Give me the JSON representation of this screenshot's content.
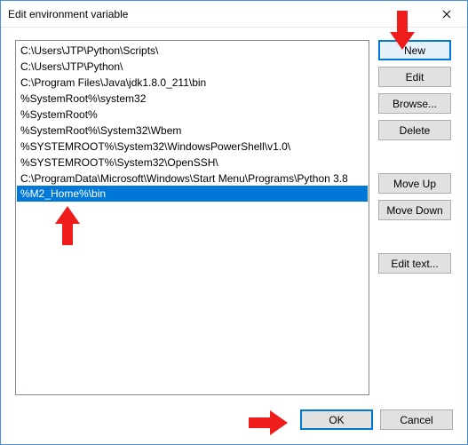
{
  "title": "Edit environment variable",
  "list": {
    "items": [
      "C:\\Users\\JTP\\Python\\Scripts\\",
      "C:\\Users\\JTP\\Python\\",
      "C:\\Program Files\\Java\\jdk1.8.0_211\\bin",
      "%SystemRoot%\\system32",
      "%SystemRoot%",
      "%SystemRoot%\\System32\\Wbem",
      "%SYSTEMROOT%\\System32\\WindowsPowerShell\\v1.0\\",
      "%SYSTEMROOT%\\System32\\OpenSSH\\",
      "C:\\ProgramData\\Microsoft\\Windows\\Start Menu\\Programs\\Python 3.8"
    ],
    "editing_value": "%M2_Home%\\bin"
  },
  "buttons": {
    "new": "New",
    "edit": "Edit",
    "browse": "Browse...",
    "delete": "Delete",
    "moveup": "Move Up",
    "movedown": "Move Down",
    "edittext": "Edit text...",
    "ok": "OK",
    "cancel": "Cancel"
  }
}
